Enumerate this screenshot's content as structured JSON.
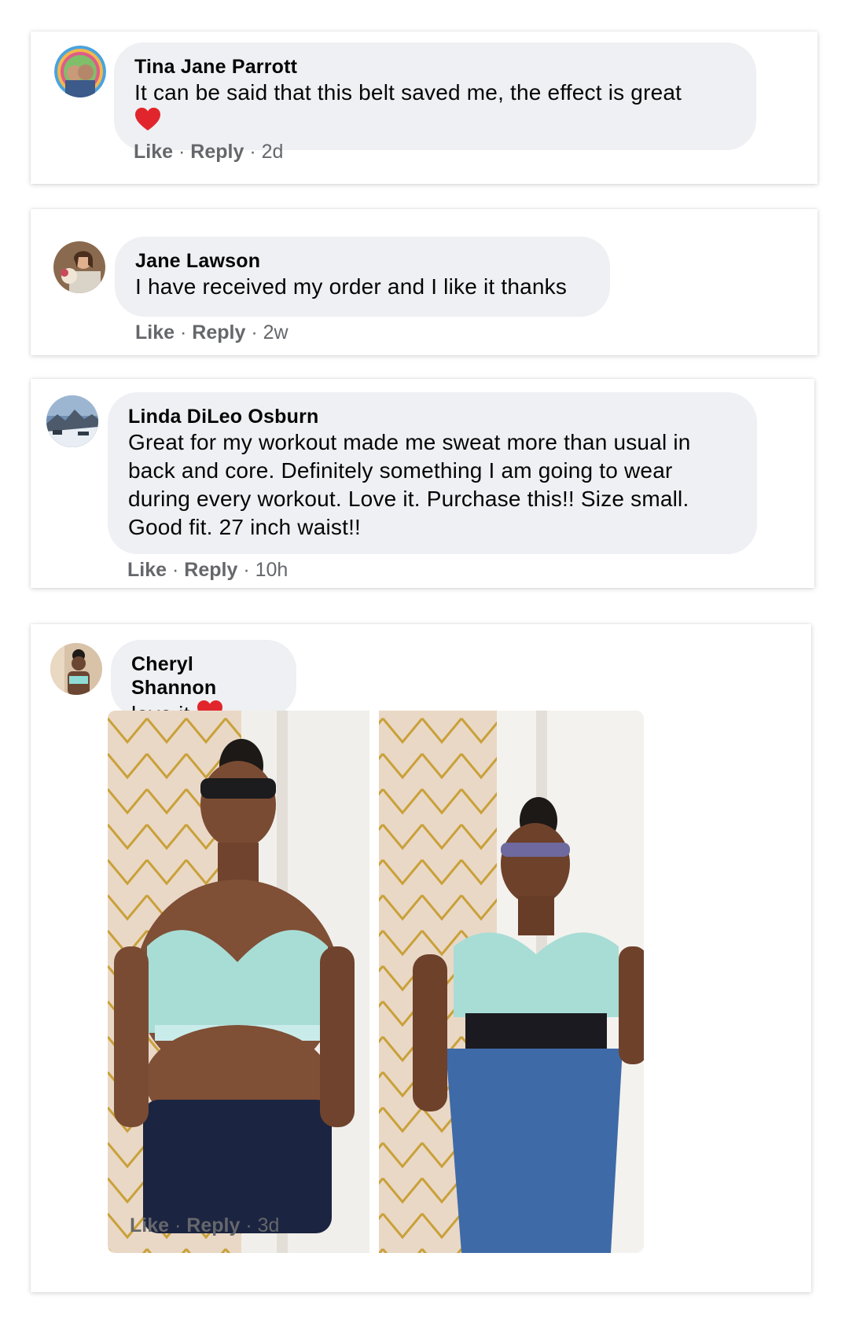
{
  "comments": [
    {
      "author": "Tina Jane Parrott",
      "text": "It can be said that this belt saved me, the effect is great",
      "like": "Like",
      "reply": "Reply",
      "time": "2d"
    },
    {
      "author": "Jane Lawson",
      "text": "I have received my order and I like it thanks",
      "like": "Like",
      "reply": "Reply",
      "time": "2w"
    },
    {
      "author": "Linda DiLeo Osburn",
      "text": "Great for my workout made me sweat more than usual in back and core. Definitely something I am going to wear during every workout. Love it. Purchase this!! Size small. Good fit. 27 inch waist!!",
      "like": "Like",
      "reply": "Reply",
      "time": "10h"
    },
    {
      "author": "Cheryl Shannon",
      "text": "love it",
      "like": "Like",
      "reply": "Reply",
      "time": "3d"
    }
  ],
  "separator": "·",
  "colors": {
    "bubble": "#eff0f3",
    "meta": "#65676b",
    "heart": "#e0262c"
  }
}
